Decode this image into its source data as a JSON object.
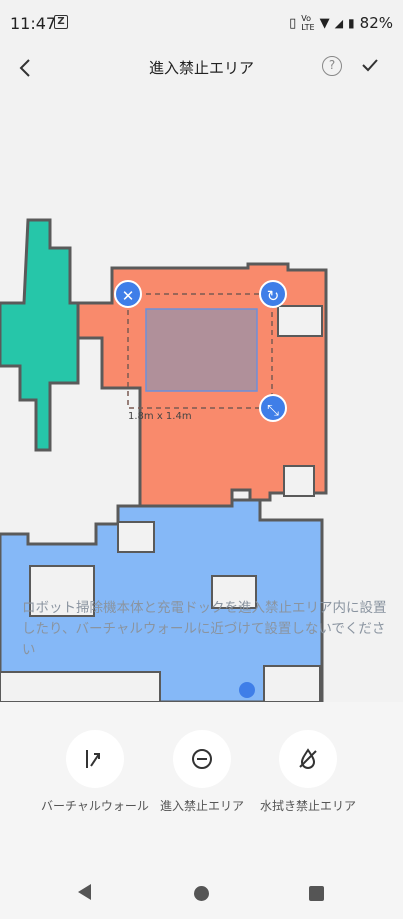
{
  "status": {
    "time": "11:47",
    "volte": "VoLTE",
    "network": "4G",
    "battery": "82%"
  },
  "header": {
    "back_icon": "back-arrow-icon",
    "title": "進入禁止エリア",
    "help_icon": "help-icon",
    "confirm_icon": "check-icon"
  },
  "map": {
    "zone_size": "1.8m x 1.4m",
    "warning": "ロボット掃除機本体と充電ドックを進入禁止エリア内に設置したり、バーチャルウォールに近づけて設置しないでください",
    "colors": {
      "room_teal": "#26c6a9",
      "room_orange": "#f98a6c",
      "room_blue": "#85b8f7",
      "wall": "#5a5a5a",
      "handle": "#3f7ee8"
    }
  },
  "tools": [
    {
      "label": "バーチャルウォール",
      "icon": "virtual-wall-icon"
    },
    {
      "label": "進入禁止エリア",
      "icon": "no-go-zone-icon"
    },
    {
      "label": "水拭き禁止エリア",
      "icon": "no-mop-zone-icon"
    }
  ]
}
